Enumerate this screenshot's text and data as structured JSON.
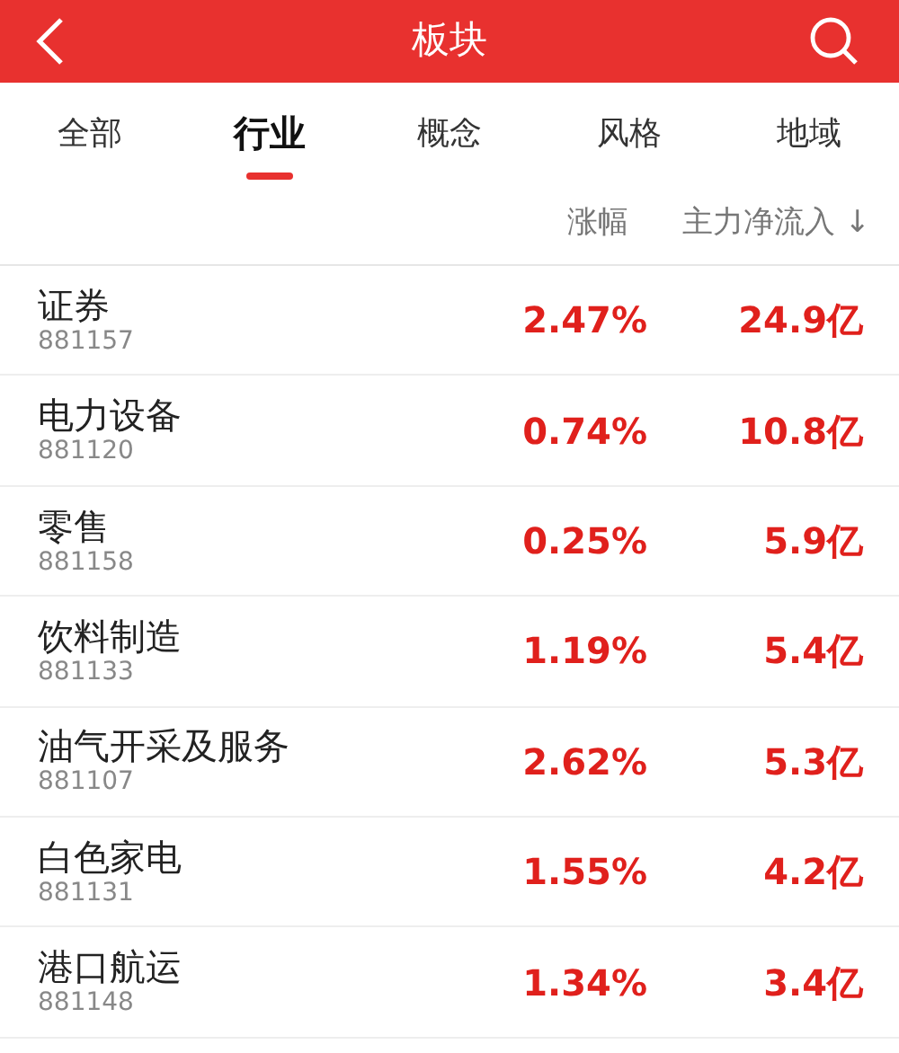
{
  "header": {
    "title": "板块"
  },
  "tabs": [
    {
      "label": "全部",
      "selected": false
    },
    {
      "label": "行业",
      "selected": true
    },
    {
      "label": "概念",
      "selected": false
    },
    {
      "label": "风格",
      "selected": false
    },
    {
      "label": "地域",
      "selected": false
    }
  ],
  "columns": [
    {
      "label": "涨幅"
    },
    {
      "label": "主力净流入",
      "sort": "↓"
    }
  ],
  "rows": [
    {
      "name": "证券",
      "code": "881157",
      "change": "2.47%",
      "inflow": "24.9亿"
    },
    {
      "name": "电力设备",
      "code": "881120",
      "change": "0.74%",
      "inflow": "10.8亿"
    },
    {
      "name": "零售",
      "code": "881158",
      "change": "0.25%",
      "inflow": "5.9亿"
    },
    {
      "name": "饮料制造",
      "code": "881133",
      "change": "1.19%",
      "inflow": "5.4亿"
    },
    {
      "name": "油气开采及服务",
      "code": "881107",
      "change": "2.62%",
      "inflow": "5.3亿"
    },
    {
      "name": "白色家电",
      "code": "881131",
      "change": "1.55%",
      "inflow": "4.2亿"
    },
    {
      "name": "港口航运",
      "code": "881148",
      "change": "1.34%",
      "inflow": "3.4亿"
    }
  ]
}
